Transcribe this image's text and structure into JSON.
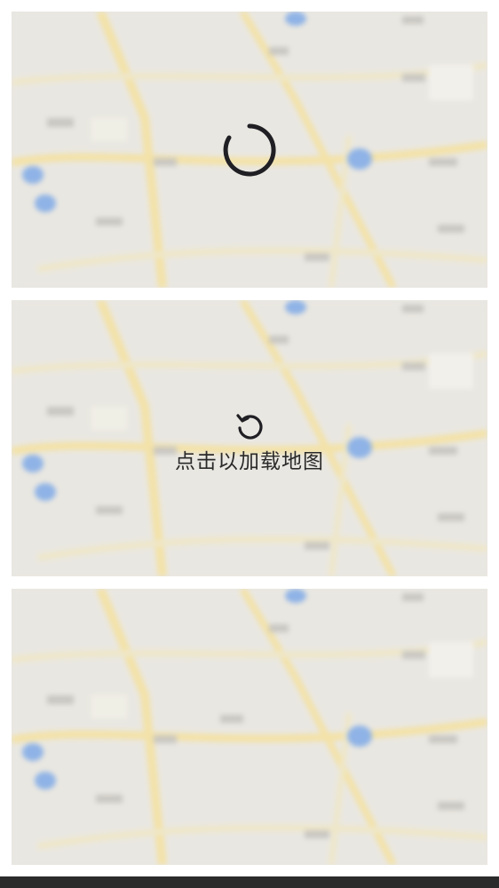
{
  "cards": [
    {
      "state": "loading",
      "spinner_icon": "loading-spinner-icon"
    },
    {
      "state": "click-to-load",
      "reload_icon": "reload-icon",
      "label": "点击以加载地图"
    },
    {
      "state": "placeholder"
    }
  ],
  "colors": {
    "map_background": "#e9e7e1",
    "road": "#f3e2a8",
    "water_marker": "#8fb3e6",
    "label_blob": "#c9c7c2",
    "spinner": "#1f1f24",
    "bottom_bar": "#2b2b2b"
  }
}
